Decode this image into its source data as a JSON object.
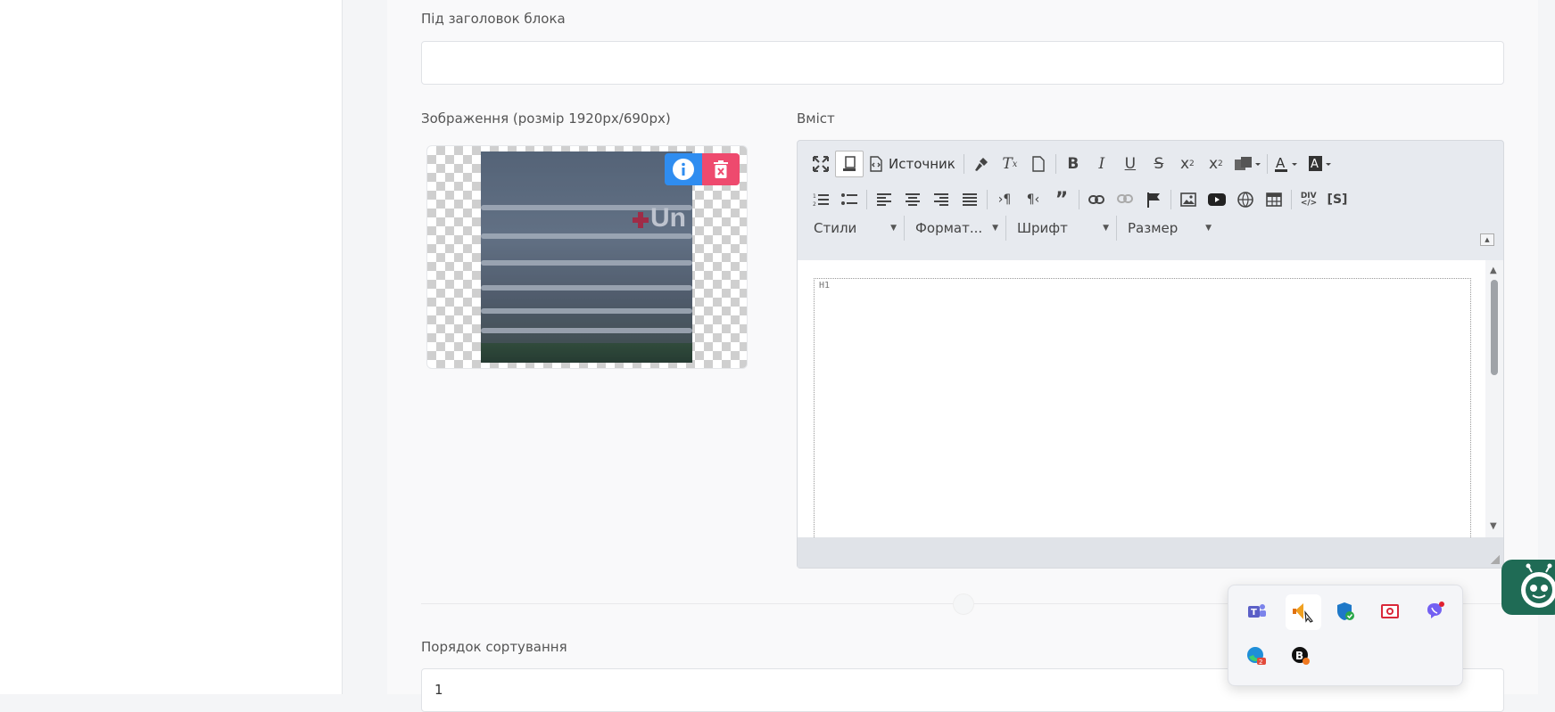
{
  "form": {
    "subheading_label": "Під заголовок блока",
    "subheading_value": "",
    "image_label": "Зображення (розмір 1920px/690px)",
    "image_caption": "Un",
    "content_label": "Вміст",
    "sort_label": "Порядок сортування",
    "sort_value": "1"
  },
  "editor": {
    "source_label": "Источник",
    "styles_label": "Стили",
    "format_label": "Формат...",
    "font_label": "Шрифт",
    "size_label": "Размер",
    "block_tag": "H1",
    "toolbar_row1": [
      "maximize-icon",
      "show-blocks-icon",
      "source-icon",
      "copy-format-icon",
      "remove-format-icon",
      "templates-icon",
      "bold-icon",
      "italic-icon",
      "underline-icon",
      "strike-icon",
      "subscript-icon",
      "superscript-icon",
      "paste-options-icon",
      "text-color-icon",
      "bg-color-icon"
    ],
    "toolbar_row2": [
      "numbered-list-icon",
      "bulleted-list-icon",
      "align-left-icon",
      "align-center-icon",
      "align-right-icon",
      "justify-icon",
      "ltr-icon",
      "rtl-icon",
      "blockquote-icon",
      "link-icon",
      "unlink-icon",
      "anchor-icon",
      "image-icon",
      "youtube-icon",
      "iframe-icon",
      "table-icon",
      "div-icon",
      "code-snippet-icon"
    ]
  },
  "tray": {
    "icons": [
      "teams-icon",
      "tray-app-icon",
      "defender-icon",
      "screenshot-icon",
      "viber-icon",
      "edge-icon",
      "b-app-icon"
    ]
  },
  "colors": {
    "accent_blue": "#2f8df0",
    "delete_red": "#ee4a6e",
    "bot_green": "#1f6b55"
  }
}
